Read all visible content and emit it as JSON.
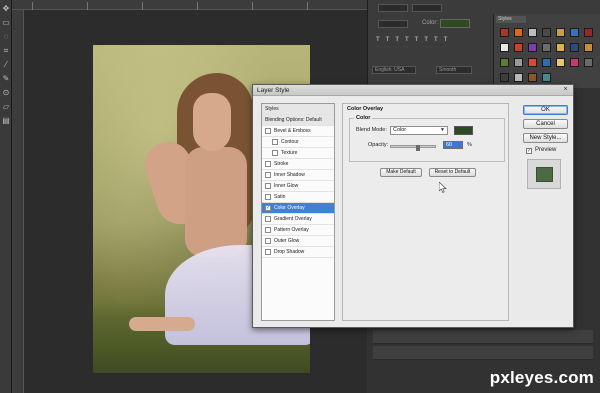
{
  "dialog": {
    "title": "Layer Style",
    "close_glyph": "×",
    "styles_list": [
      {
        "label": "Styles",
        "kind": "header"
      },
      {
        "label": "Blending Options: Default",
        "kind": "header"
      },
      {
        "label": "Bevel & Emboss",
        "kind": "check",
        "checked": false
      },
      {
        "label": "Contour",
        "kind": "sub",
        "checked": false
      },
      {
        "label": "Texture",
        "kind": "sub",
        "checked": false
      },
      {
        "label": "Stroke",
        "kind": "check",
        "checked": false
      },
      {
        "label": "Inner Shadow",
        "kind": "check",
        "checked": false
      },
      {
        "label": "Inner Glow",
        "kind": "check",
        "checked": false
      },
      {
        "label": "Satin",
        "kind": "check",
        "checked": false
      },
      {
        "label": "Color Overlay",
        "kind": "check",
        "checked": true,
        "selected": true
      },
      {
        "label": "Gradient Overlay",
        "kind": "check",
        "checked": false
      },
      {
        "label": "Pattern Overlay",
        "kind": "check",
        "checked": false
      },
      {
        "label": "Outer Glow",
        "kind": "check",
        "checked": false
      },
      {
        "label": "Drop Shadow",
        "kind": "check",
        "checked": false
      }
    ],
    "section_title": "Color Overlay",
    "group_title": "Color",
    "blend_mode_label": "Blend Mode:",
    "blend_mode_value": "Color",
    "overlay_color": "#2e4a22",
    "opacity_label": "Opacity:",
    "opacity_value": "60",
    "opacity_unit": "%",
    "make_default_label": "Make Default",
    "reset_default_label": "Reset to Default",
    "ok_label": "OK",
    "cancel_label": "Cancel",
    "new_style_label": "New Style...",
    "preview_label": "Preview",
    "preview_checked": true
  },
  "right_panel": {
    "color_label": "Color:",
    "styles_tab": "Styles",
    "language": "English: USA",
    "anti_alias": "Smooth"
  },
  "watermark": "pxleyes.com",
  "icons": {
    "check": "✓",
    "dropdown": "▼",
    "cursor": "arrow-cursor-icon"
  },
  "colors": {
    "selection": "#3f82d4",
    "overlay_swatch": "#2e4a22",
    "preview_swatch": "#4c6b42"
  }
}
